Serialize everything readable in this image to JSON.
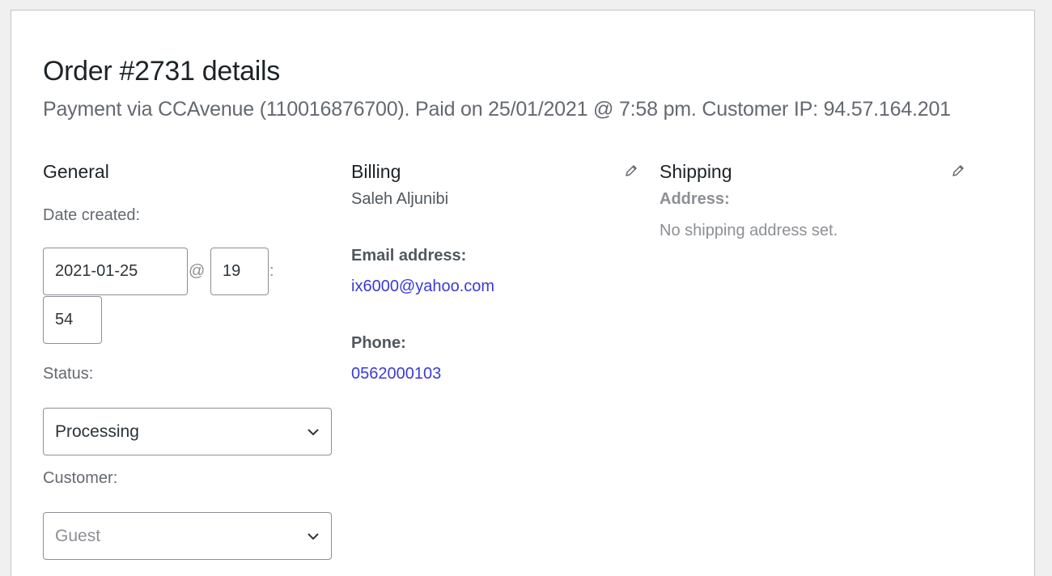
{
  "order": {
    "title": "Order #2731 details",
    "meta": "Payment via CCAvenue (110016876700). Paid on 25/01/2021 @ 7:58 pm. Customer IP: 94.57.164.201"
  },
  "general": {
    "heading": "General",
    "date_created_label": "Date created:",
    "date_value": "2021-01-25",
    "at_symbol": "@",
    "hour_value": "19",
    "colon": ":",
    "minute_value": "54",
    "status_label": "Status:",
    "status_value": "Processing",
    "customer_label": "Customer:",
    "customer_placeholder": "Guest"
  },
  "billing": {
    "heading": "Billing",
    "name": "Saleh Aljunibi",
    "email_label": "Email address:",
    "email_value": "ix6000@yahoo.com",
    "phone_label": "Phone:",
    "phone_value": "0562000103",
    "edit_icon": "pencil-icon"
  },
  "shipping": {
    "heading": "Shipping",
    "address_label": "Address:",
    "address_value": "No shipping address set.",
    "edit_icon": "pencil-icon"
  },
  "colors": {
    "link": "#3a3ad6",
    "border": "#8c8f94",
    "panel_bg": "#ffffff",
    "page_bg": "#f0f0f1"
  }
}
